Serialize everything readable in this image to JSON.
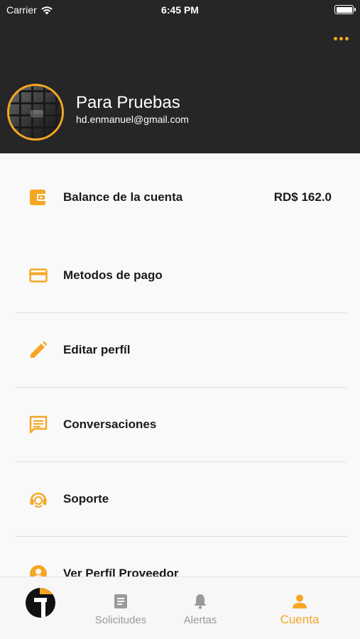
{
  "status_bar": {
    "carrier": "Carrier",
    "time": "6:45 PM"
  },
  "header": {
    "more_icon": "more-horizontal-icon",
    "name": "Para Pruebas",
    "email": "hd.enmanuel@gmail.com"
  },
  "menu": [
    {
      "label": "Balance de la cuenta",
      "value": "RD$ 162.0",
      "icon": "wallet-icon"
    },
    {
      "label": "Metodos de pago",
      "icon": "credit-card-icon"
    },
    {
      "label": "Editar perfíl",
      "icon": "pencil-icon"
    },
    {
      "label": "Conversaciones",
      "icon": "chat-icon"
    },
    {
      "label": "Soporte",
      "icon": "headset-icon"
    },
    {
      "label": "Ver Perfíl Proveedor",
      "icon": "person-icon"
    }
  ],
  "tabbar": {
    "tabs": [
      {
        "label": "Solicitudes",
        "icon": "document-icon",
        "active": false
      },
      {
        "label": "Alertas",
        "icon": "bell-icon",
        "active": false
      },
      {
        "label": "Cuenta",
        "icon": "person-icon",
        "active": true
      }
    ]
  },
  "colors": {
    "accent": "#f5a623",
    "header_bg": "#262626",
    "background": "#f9f9f9"
  }
}
